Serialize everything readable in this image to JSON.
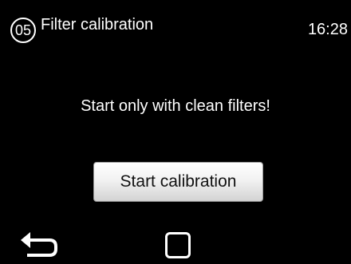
{
  "header": {
    "step_number": "05",
    "title": "Filter calibration",
    "time": "16:28"
  },
  "main": {
    "message": "Start only with clean filters!",
    "start_button_label": "Start calibration"
  },
  "nav": {
    "back_icon": "back-arrow-icon",
    "home_icon": "square-home-icon"
  },
  "colors": {
    "background": "#000000",
    "text": "#ffffff",
    "button_face": "#f2f2f2",
    "button_text": "#111111"
  }
}
